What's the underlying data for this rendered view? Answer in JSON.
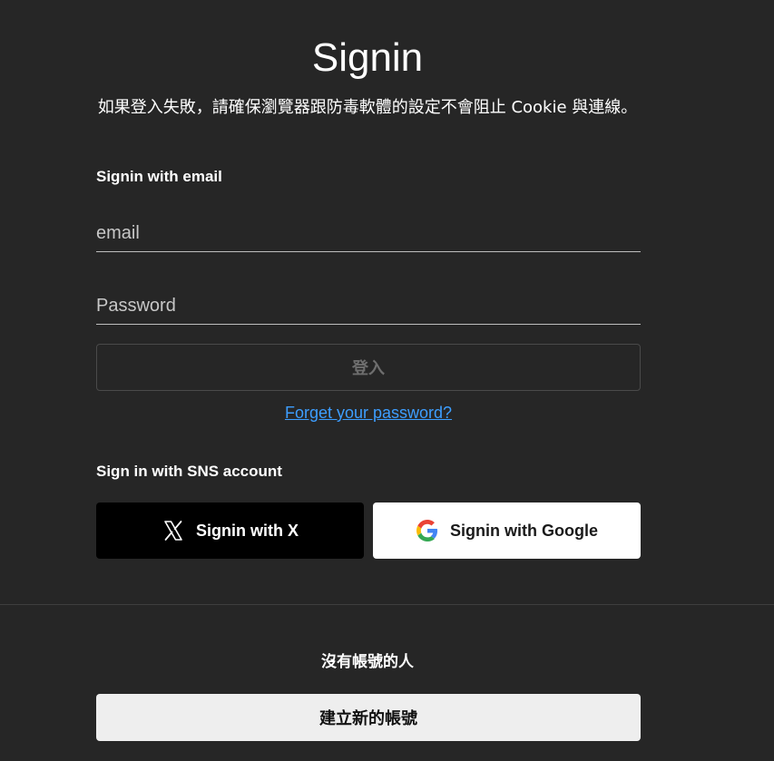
{
  "header": {
    "title": "Signin",
    "notice": "如果登入失敗，請確保瀏覽器跟防毒軟體的設定不會阻止 Cookie 與連線。"
  },
  "email_section": {
    "label": "Signin with email",
    "email_placeholder": "email",
    "email_value": "",
    "password_placeholder": "Password",
    "password_value": "",
    "login_button": "登入",
    "forgot_link": "Forget your password?"
  },
  "sns_section": {
    "label": "Sign in with SNS account",
    "x_button": "Signin with X",
    "x_icon": "x-logo-icon",
    "google_button": "Signin with Google",
    "google_icon": "google-logo-icon"
  },
  "register_section": {
    "label": "沒有帳號的人",
    "create_button": "建立新的帳號"
  },
  "colors": {
    "background": "#262626",
    "link": "#3d9eff",
    "x_button_bg": "#000000",
    "google_button_bg": "#ffffff",
    "create_button_bg": "#eeeeee"
  }
}
